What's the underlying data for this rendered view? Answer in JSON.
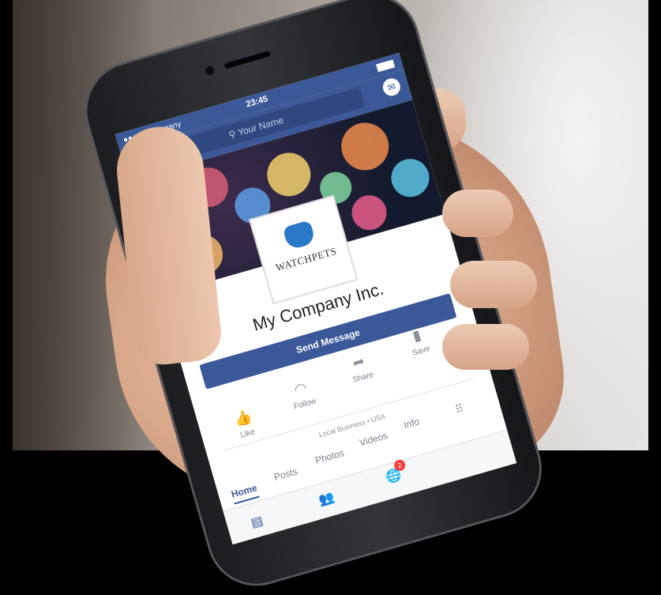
{
  "status_bar": {
    "carrier": "Company",
    "time": "23:45"
  },
  "nav": {
    "search_placeholder": "Your Name"
  },
  "page": {
    "logo_text": "WATCHPETS",
    "name": "My Company Inc.",
    "send_button": "Send Message",
    "actions": [
      "Like",
      "Follow",
      "Share",
      "Save"
    ],
    "category": "Local Business",
    "location": "USA"
  },
  "tabs": [
    "Home",
    "Posts",
    "Photos",
    "Videos",
    "Info"
  ],
  "notifications": {
    "badge_count": "2"
  },
  "icons": {
    "back": "chevron-left-icon",
    "search": "search-icon",
    "messenger": "messenger-icon",
    "like": "thumbs-up-icon",
    "follow": "rss-icon",
    "share": "share-arrow-icon",
    "save": "bookmark-icon",
    "grid": "grid-icon",
    "feed": "feed-icon",
    "friends": "friends-icon",
    "globe": "globe-icon"
  },
  "colors": {
    "facebook_blue": "#3b5998",
    "badge_red": "#fa3e3e"
  }
}
